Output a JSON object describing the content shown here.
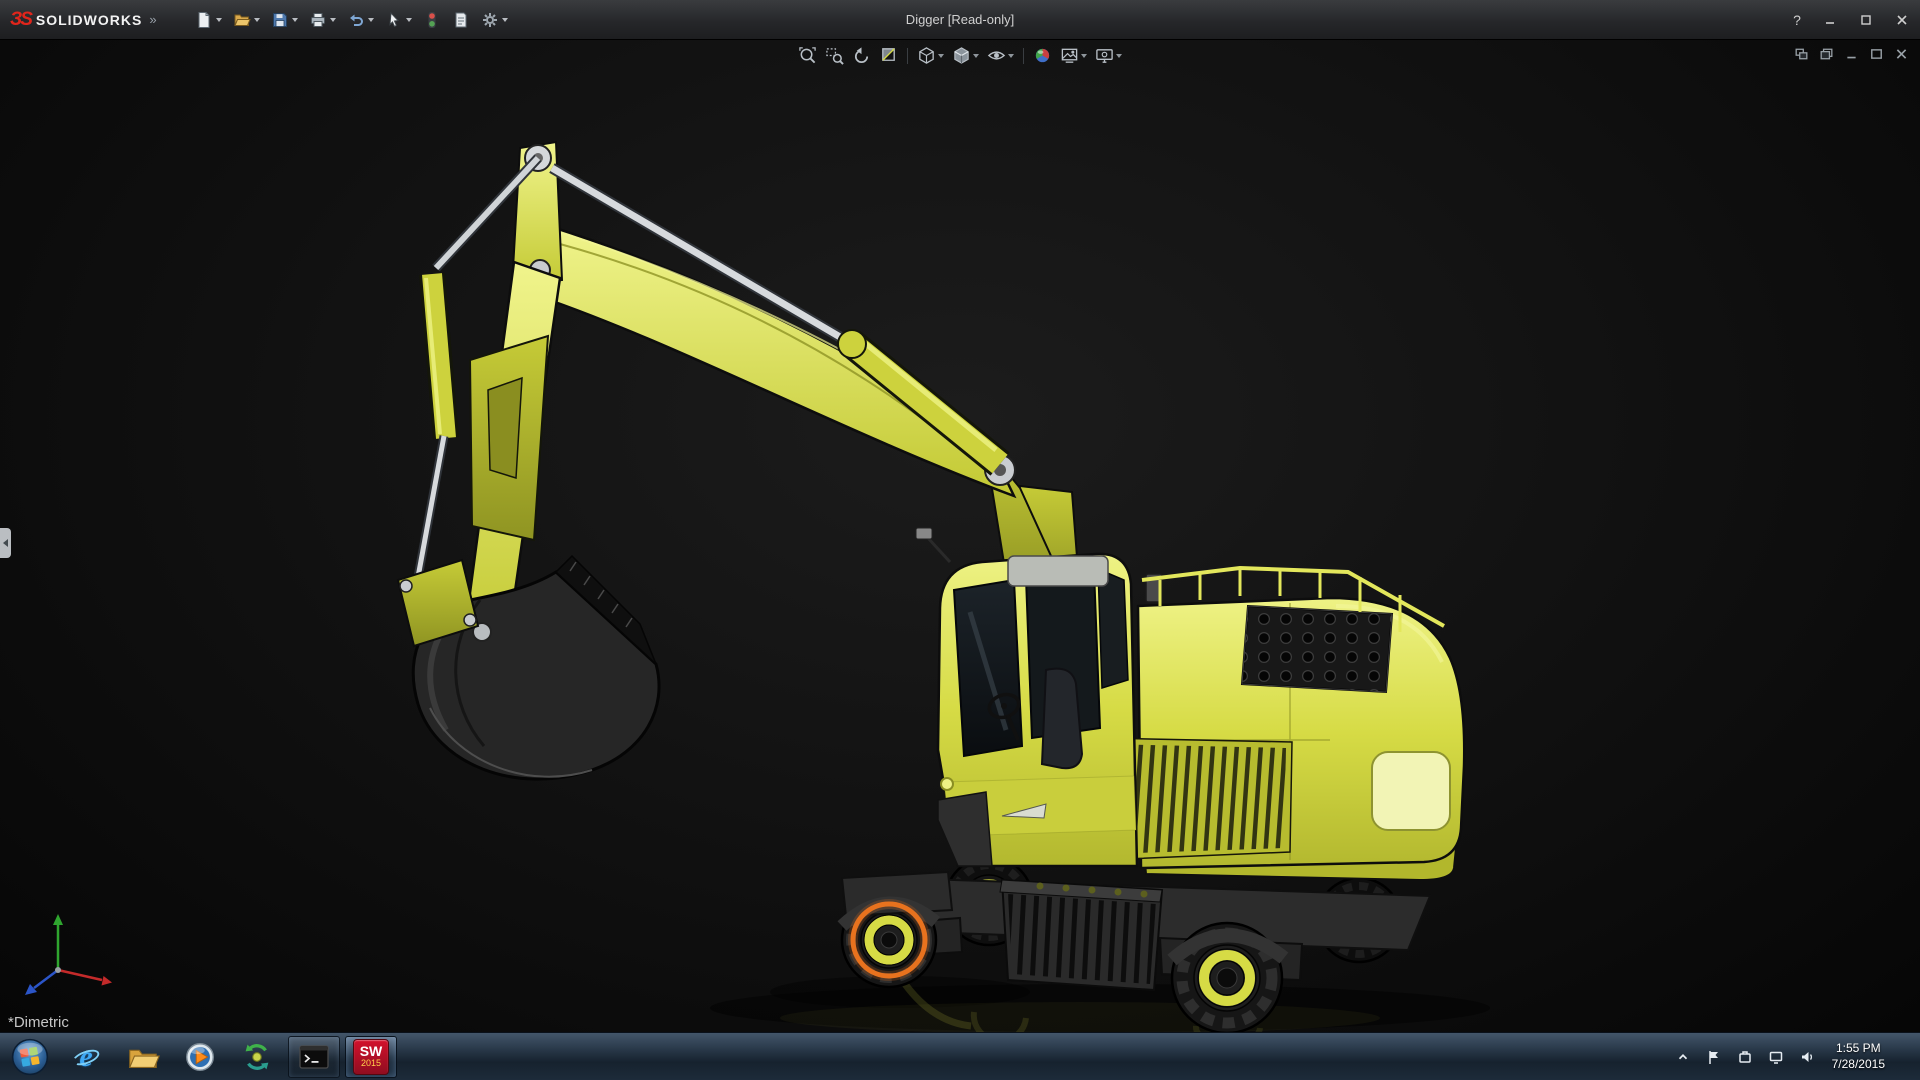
{
  "window": {
    "title": "Digger [Read-only]"
  },
  "brand": {
    "mark": "ЗS",
    "name": "SOLIDWORKS",
    "expand_glyph": "»"
  },
  "titlebar": {
    "tools": [
      {
        "name": "new-document",
        "dropdown": true
      },
      {
        "name": "open",
        "dropdown": true
      },
      {
        "name": "save",
        "dropdown": true
      },
      {
        "name": "print",
        "dropdown": true
      },
      {
        "name": "undo",
        "dropdown": true
      },
      {
        "name": "select",
        "dropdown": true
      },
      {
        "name": "rebuild",
        "dropdown": false
      },
      {
        "name": "file-properties",
        "dropdown": false
      },
      {
        "name": "options",
        "dropdown": true
      }
    ],
    "help_glyph": "?",
    "window_controls": [
      "minimize",
      "maximize",
      "close"
    ]
  },
  "viewport": {
    "heads_up_tools": [
      "zoom-to-fit",
      "zoom-to-area",
      "previous-view",
      "section-view",
      "view-orientation",
      "display-style",
      "hide-show-items",
      "edit-appearance",
      "apply-scene",
      "view-settings"
    ],
    "doc_window_controls": [
      "tile-window",
      "restore-window",
      "minimize-window",
      "maximize-window",
      "close-window"
    ],
    "orientation_label": "*Dimetric",
    "model_component_selected": "front-wheel",
    "selection_color": "#e8731e"
  },
  "taskbar": {
    "items": [
      "start",
      "internet-explorer",
      "windows-explorer",
      "media-player",
      "solidworks",
      "command-prompt",
      "solidworks-2015"
    ],
    "ie_glyph": "e",
    "solidworks_badge": {
      "line1": "SW",
      "line2": "2015"
    },
    "tray_icons": [
      "show-hidden-icons",
      "action-center-flag",
      "device",
      "display",
      "volume"
    ],
    "clock": {
      "time": "1:55 PM",
      "date": "7/28/2015"
    }
  },
  "colors": {
    "model_yellow": "#d6db45",
    "model_yellow_light": "#eef285",
    "model_yellow_dark": "#a8ad28",
    "selection_orange": "#e8731e",
    "viewport_bg": "#0e0e0e",
    "titlebar_bg": "#2b2c2e",
    "taskbar_bg": "#22303f",
    "brand_red": "#e1251b",
    "triad_x": "#c42a2a",
    "triad_y": "#2fa52f",
    "triad_z": "#2b55c8"
  }
}
